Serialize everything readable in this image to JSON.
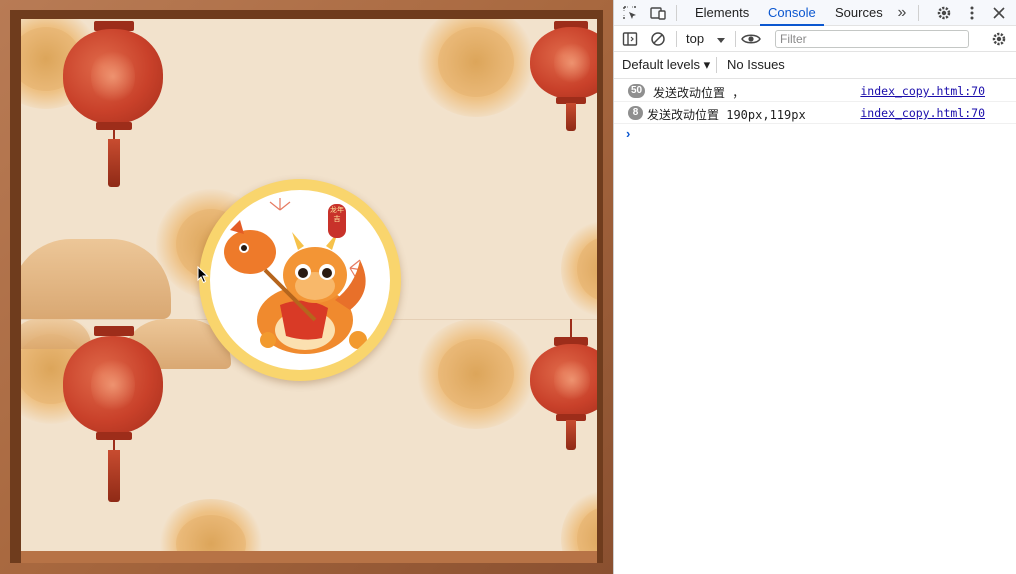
{
  "devtools": {
    "tabs": [
      {
        "label": "Elements"
      },
      {
        "label": "Console"
      },
      {
        "label": "Sources"
      }
    ],
    "more_tabs_glyph": "»",
    "context_label": "top",
    "filter_placeholder": "Filter",
    "levels_label": "Default levels ▾",
    "issues_label": "No Issues",
    "logs": [
      {
        "count": "50",
        "message": "发送改动位置 ，",
        "source": "index_copy.html:70"
      },
      {
        "count": "8",
        "message": "发送改动位置 190px,119px",
        "source": "index_copy.html:70"
      }
    ],
    "prompt_glyph": "›"
  },
  "preview": {
    "medallion_badge_text": "龙年吉"
  },
  "colors": {
    "accent": "#0b57d0",
    "frame": "#a8683f",
    "background": "#f2e2cc",
    "lantern": "#c9412a",
    "medallion_ring": "#f9d56d"
  }
}
